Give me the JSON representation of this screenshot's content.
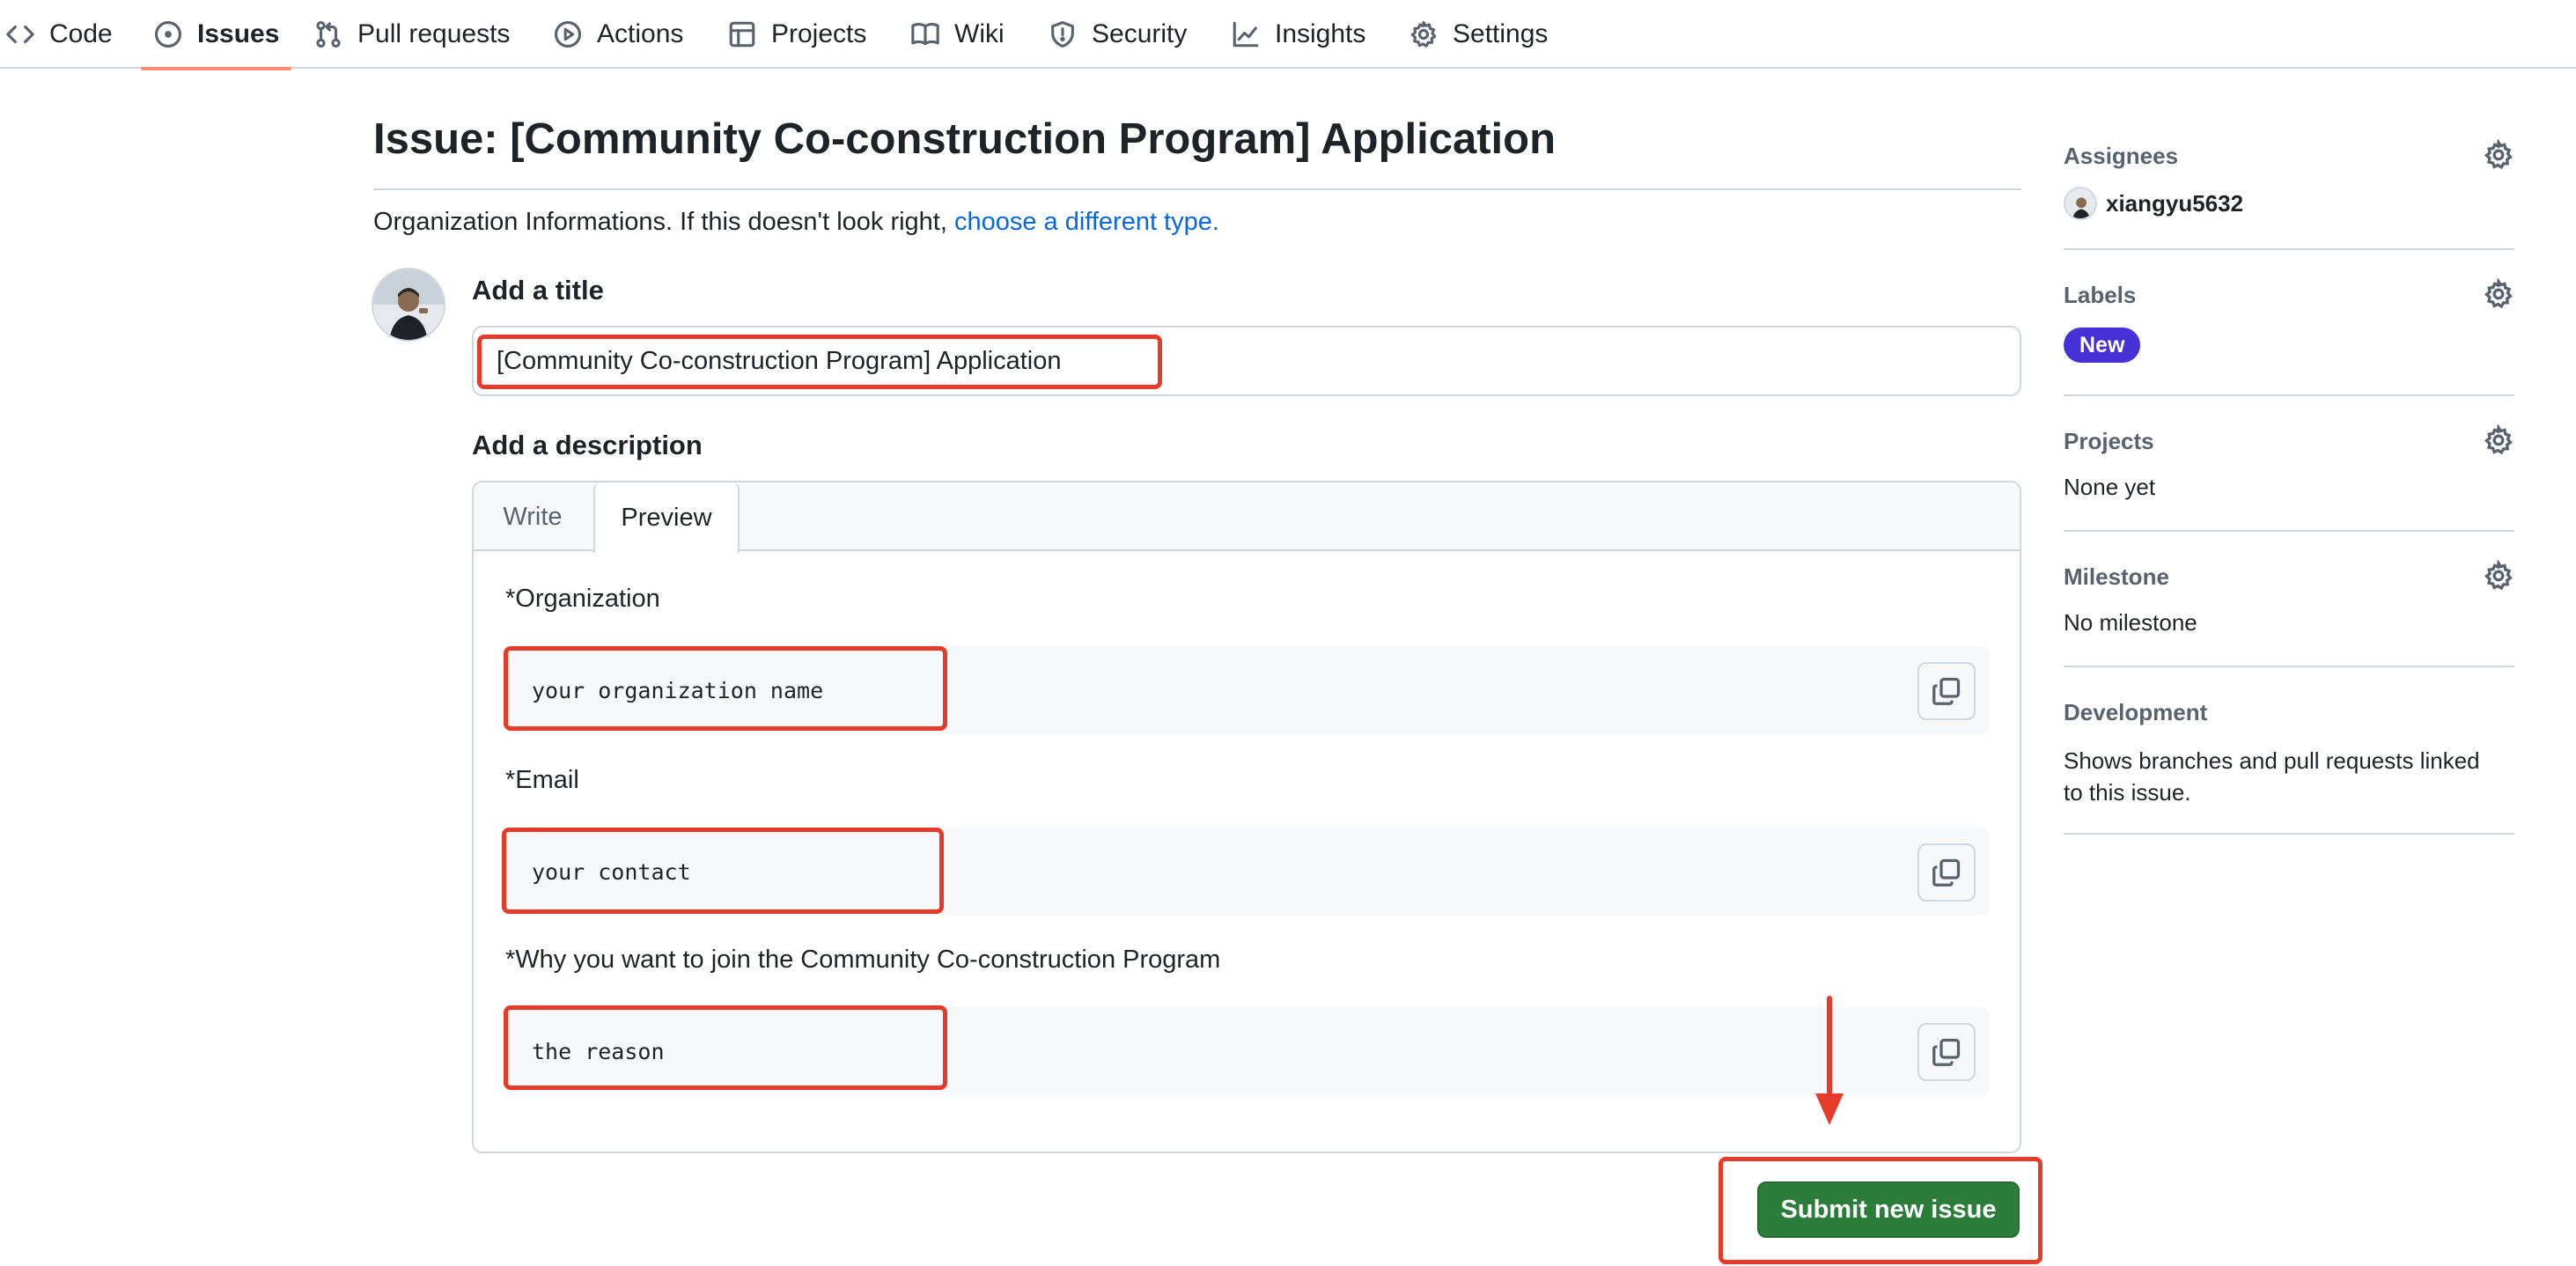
{
  "nav": {
    "items": [
      {
        "label": "Code",
        "icon": "code-icon"
      },
      {
        "label": "Issues",
        "icon": "issue-opened-icon",
        "active": true
      },
      {
        "label": "Pull requests",
        "icon": "git-pull-request-icon"
      },
      {
        "label": "Actions",
        "icon": "play-icon"
      },
      {
        "label": "Projects",
        "icon": "table-icon"
      },
      {
        "label": "Wiki",
        "icon": "book-icon"
      },
      {
        "label": "Security",
        "icon": "shield-icon"
      },
      {
        "label": "Insights",
        "icon": "graph-icon"
      },
      {
        "label": "Settings",
        "icon": "gear-icon"
      }
    ],
    "active_color": "#fd8c73"
  },
  "issue": {
    "heading": "Issue: [Community Co-construction Program] Application",
    "info_text": "Organization Informations. If this doesn't look right, ",
    "info_link": "choose a different type."
  },
  "form": {
    "title_label": "Add a title",
    "title_value": "[Community Co-construction Program] Application",
    "description_label": "Add a description",
    "tabs": {
      "write": "Write",
      "preview": "Preview"
    },
    "fields": [
      {
        "label": "*Organization",
        "value": "your organization name"
      },
      {
        "label": "*Email",
        "value": "your contact"
      },
      {
        "label": "*Why you want to join the Community Co-construction Program",
        "value": "the reason"
      }
    ],
    "submit_label": "Submit new issue",
    "submit_color": "#2c7d3c"
  },
  "sidebar": {
    "assignees": {
      "heading": "Assignees",
      "user": "xiangyu5632"
    },
    "labels": {
      "heading": "Labels",
      "label": "New",
      "label_color": "#4731d6"
    },
    "projects": {
      "heading": "Projects",
      "value": "None yet"
    },
    "milestone": {
      "heading": "Milestone",
      "value": "No milestone"
    },
    "development": {
      "heading": "Development",
      "value": "Shows branches and pull requests linked to this issue."
    }
  },
  "annotation_color": "#e53b2a"
}
